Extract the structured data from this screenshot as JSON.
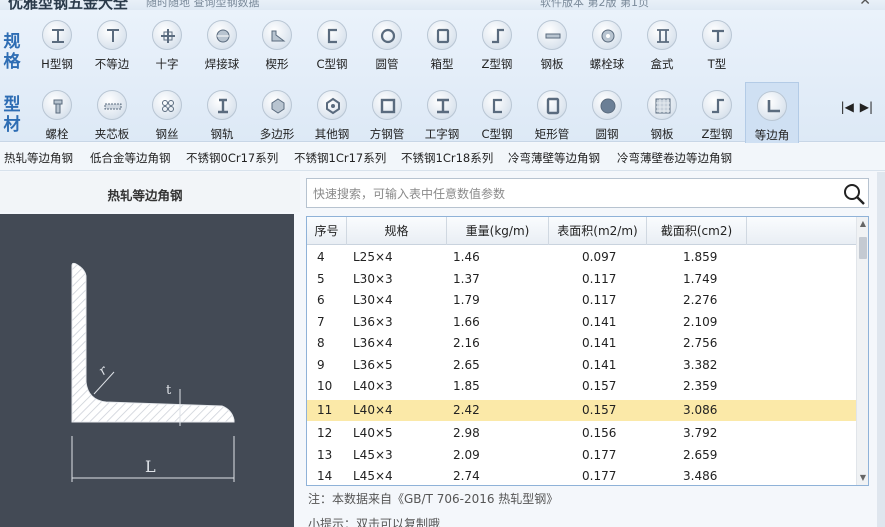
{
  "app": {
    "title": "优雅型钢五金大全",
    "subtitle": "随时随地 查询型钢数据",
    "meta": "软件版本 第2版 第1页",
    "close_icon": "close-icon"
  },
  "toolbar": {
    "group_top_label": "规格",
    "group_bottom_label": "型材",
    "row1": [
      {
        "label": "H型钢",
        "icon": "h-beam-icon"
      },
      {
        "label": "不等边",
        "icon": "unequal-angle-icon"
      },
      {
        "label": "十字",
        "icon": "cross-icon"
      },
      {
        "label": "焊接球",
        "icon": "weld-ball-icon"
      },
      {
        "label": "楔形",
        "icon": "wedge-icon"
      },
      {
        "label": "C型钢",
        "icon": "c-channel-icon"
      },
      {
        "label": "圆管",
        "icon": "round-tube-icon"
      },
      {
        "label": "箱型",
        "icon": "box-section-icon"
      },
      {
        "label": "Z型钢",
        "icon": "z-section-icon"
      },
      {
        "label": "钢板",
        "icon": "steel-plate-icon"
      },
      {
        "label": "螺栓球",
        "icon": "bolt-ball-icon"
      },
      {
        "label": "盒式",
        "icon": "box-type-icon"
      },
      {
        "label": "T型",
        "icon": "t-section-icon"
      }
    ],
    "row2": [
      {
        "label": "螺栓",
        "icon": "bolt-icon"
      },
      {
        "label": "夹芯板",
        "icon": "sandwich-panel-icon"
      },
      {
        "label": "钢丝",
        "icon": "steel-wire-icon"
      },
      {
        "label": "钢轨",
        "icon": "rail-icon"
      },
      {
        "label": "多边形",
        "icon": "polygon-icon"
      },
      {
        "label": "其他钢",
        "icon": "other-steel-icon"
      },
      {
        "label": "方钢管",
        "icon": "square-tube-icon"
      },
      {
        "label": "工字钢",
        "icon": "i-beam-icon"
      },
      {
        "label": "C型钢",
        "icon": "c-channel-icon"
      },
      {
        "label": "矩形管",
        "icon": "rect-tube-icon"
      },
      {
        "label": "圆钢",
        "icon": "round-bar-icon"
      },
      {
        "label": "钢板",
        "icon": "checker-plate-icon"
      },
      {
        "label": "Z型钢",
        "icon": "z-section-icon"
      },
      {
        "label": "等边角",
        "icon": "equal-angle-icon"
      }
    ],
    "active_index_row2": 13,
    "prev_label": "|◀",
    "next_label": "▶|"
  },
  "subtabs": [
    "热轧等边角钢",
    "低合金等边角钢",
    "不锈钢0Cr17系列",
    "不锈钢1Cr17系列",
    "不锈钢1Cr18系列",
    "冷弯薄壁等边角钢",
    "冷弯薄壁卷边等边角钢"
  ],
  "left": {
    "title": "热轧等边角钢",
    "dim_r": "r",
    "dim_t": "t",
    "dim_L": "L"
  },
  "search": {
    "placeholder": "快速搜索，可输入表中任意数值参数",
    "value": ""
  },
  "table": {
    "columns": [
      "序号",
      "规格",
      "重量(kg/m)",
      "表面积(m2/m)",
      "截面积(cm2)"
    ],
    "rows": [
      [
        "4",
        "L25×4",
        "1.46",
        "0.097",
        "1.859"
      ],
      [
        "5",
        "L30×3",
        "1.37",
        "0.117",
        "1.749"
      ],
      [
        "6",
        "L30×4",
        "1.79",
        "0.117",
        "2.276"
      ],
      [
        "7",
        "L36×3",
        "1.66",
        "0.141",
        "2.109"
      ],
      [
        "8",
        "L36×4",
        "2.16",
        "0.141",
        "2.756"
      ],
      [
        "9",
        "L36×5",
        "2.65",
        "0.141",
        "3.382"
      ],
      [
        "10",
        "L40×3",
        "1.85",
        "0.157",
        "2.359"
      ],
      [
        "11",
        "L40×4",
        "2.42",
        "0.157",
        "3.086"
      ],
      [
        "12",
        "L40×5",
        "2.98",
        "0.156",
        "3.792"
      ],
      [
        "13",
        "L45×3",
        "2.09",
        "0.177",
        "2.659"
      ],
      [
        "14",
        "L45×4",
        "2.74",
        "0.177",
        "3.486"
      ]
    ],
    "selected_row": "11",
    "selected_color": "#fbe9a8"
  },
  "note": "注：本数据来自《GB/T 706-2016 热轧型钢》",
  "tip": "小提示：双击可以复制哦",
  "colors": {
    "accent": "#2e6db4",
    "diagram_bg": "#434a55",
    "table_border": "#8fb2d8"
  }
}
